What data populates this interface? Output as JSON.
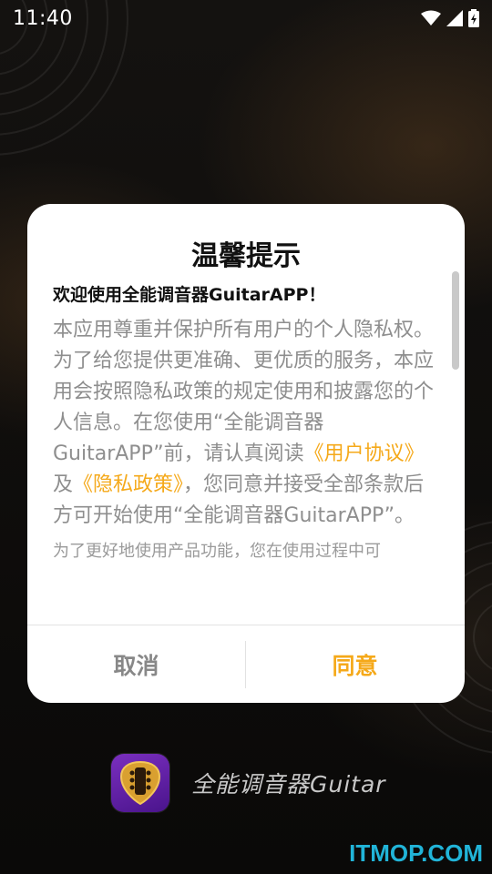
{
  "status_bar": {
    "time": "11:40"
  },
  "dialog": {
    "title": "温馨提示",
    "welcome": "欢迎使用全能调音器GuitarAPP！",
    "body_part1": "本应用尊重并保护所有用户的个人隐私权。为了给您提供更准确、更优质的服务，本应用会按照隐私政策的规定使用和披露您的个人信息。在您使用“全能调音器GuitarAPP”前，请认真阅读",
    "link_user_agreement": "《用户协议》",
    "body_and": "及",
    "link_privacy_policy": "《隐私政策》",
    "body_part2": "，您同意并接受全部条款后方可开始使用“全能调音器GuitarAPP”。",
    "body_next": "为了更好地使用产品功能，您在使用过程中可",
    "cancel_label": "取消",
    "agree_label": "同意"
  },
  "app": {
    "name": "全能调音器Guitar"
  },
  "watermark": "ITMOP.COM",
  "colors": {
    "accent": "#f5a91a",
    "watermark": "#21b4d8"
  }
}
